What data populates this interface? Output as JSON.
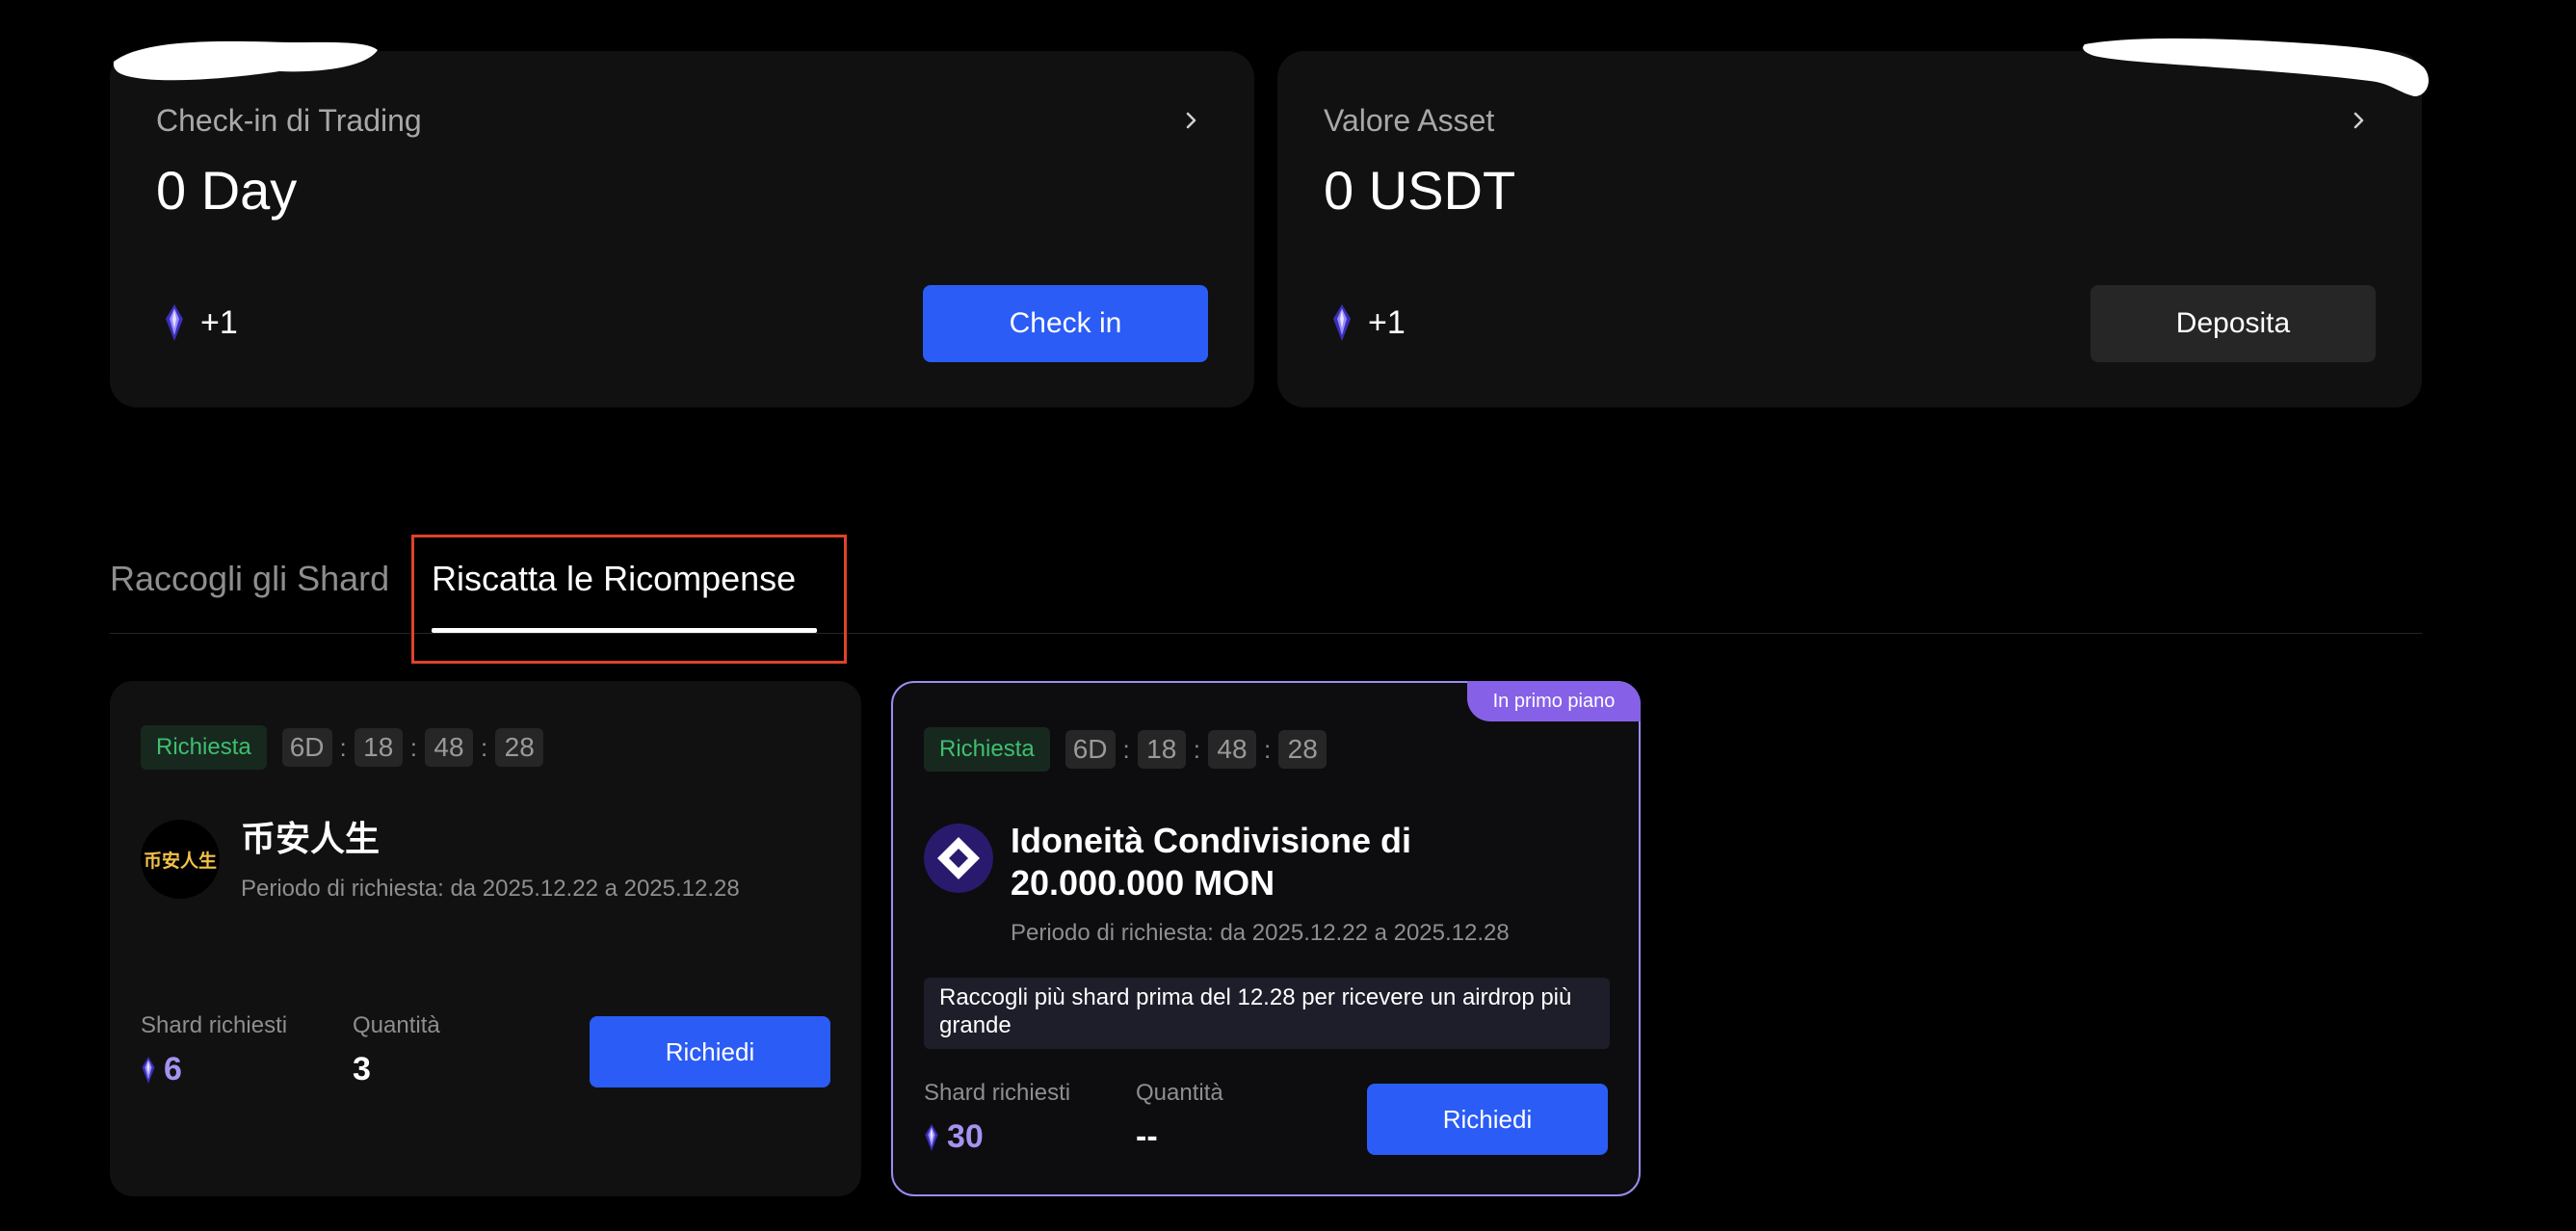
{
  "checkin_card": {
    "title": "Check-in di Trading",
    "value": "0 Day",
    "reward": "+1",
    "button_label": "Check in"
  },
  "asset_card": {
    "title": "Valore Asset",
    "value": "0 USDT",
    "reward": "+1",
    "button_label": "Deposita"
  },
  "tabs": [
    {
      "label": "Raccogli gli Shard",
      "active": false
    },
    {
      "label": "Riscatta le Ricompense",
      "active": true
    }
  ],
  "rewards": [
    {
      "status": "Richiesta",
      "countdown": {
        "days": "6D",
        "hours": "18",
        "minutes": "48",
        "seconds": "28"
      },
      "logo_text": "币安人生",
      "title": "币安人生",
      "period": "Periodo di richiesta: da 2025.12.22 a 2025.12.28",
      "shard_label": "Shard richiesti",
      "shard_value": "6",
      "qty_label": "Quantità",
      "qty_value": "3",
      "button_label": "Richiedi"
    },
    {
      "featured_label": "In primo piano",
      "status": "Richiesta",
      "countdown": {
        "days": "6D",
        "hours": "18",
        "minutes": "48",
        "seconds": "28"
      },
      "title": "Idoneità Condivisione di 20.000.000 MON",
      "period": "Periodo di richiesta: da 2025.12.22 a 2025.12.28",
      "note": "Raccogli più shard prima del 12.28 per ricevere un airdrop più grande",
      "shard_label": "Shard richiesti",
      "shard_value": "30",
      "qty_label": "Quantità",
      "qty_value": "--",
      "button_label": "Richiedi"
    }
  ],
  "colors": {
    "accent_blue": "#2b5cf6",
    "status_green": "#3fbf6f",
    "featured_purple": "#8661e8",
    "shard_purple": "#a592f0",
    "highlight_red": "#e0412a"
  }
}
